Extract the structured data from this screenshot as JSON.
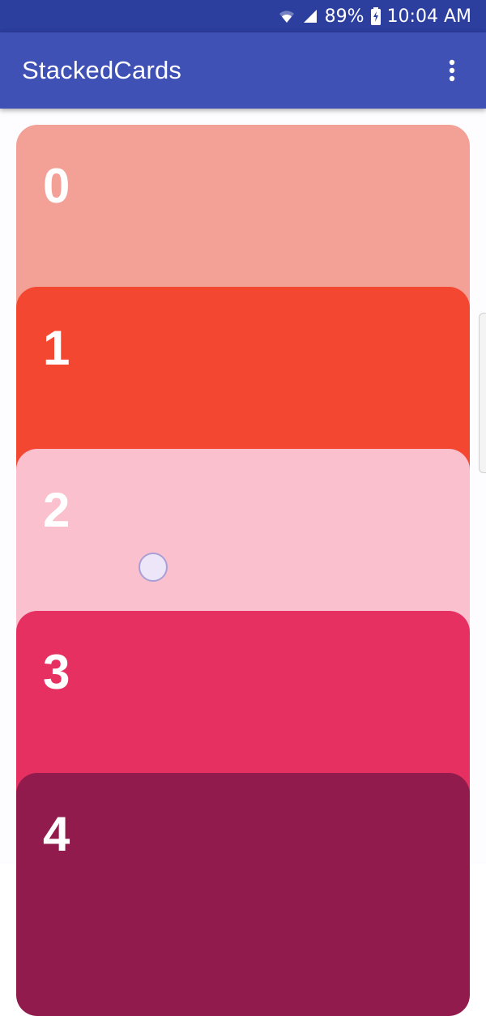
{
  "status_bar": {
    "battery_percent": "89%",
    "time": "10:04 AM",
    "icons": [
      "wifi-icon",
      "cell-signal-icon",
      "battery-charging-icon"
    ]
  },
  "app_bar": {
    "title": "StackedCards",
    "menu_icon": "more-vert-icon"
  },
  "cards": [
    {
      "label": "0",
      "color": "#f3a196"
    },
    {
      "label": "1",
      "color": "#f44731"
    },
    {
      "label": "2",
      "color": "#fbc0cd"
    },
    {
      "label": "3",
      "color": "#e73062"
    },
    {
      "label": "4",
      "color": "#921b4e"
    }
  ],
  "colors": {
    "status_bar": "#2c3e9e",
    "app_bar": "#3f51b5",
    "background": "#fdfcfe"
  }
}
